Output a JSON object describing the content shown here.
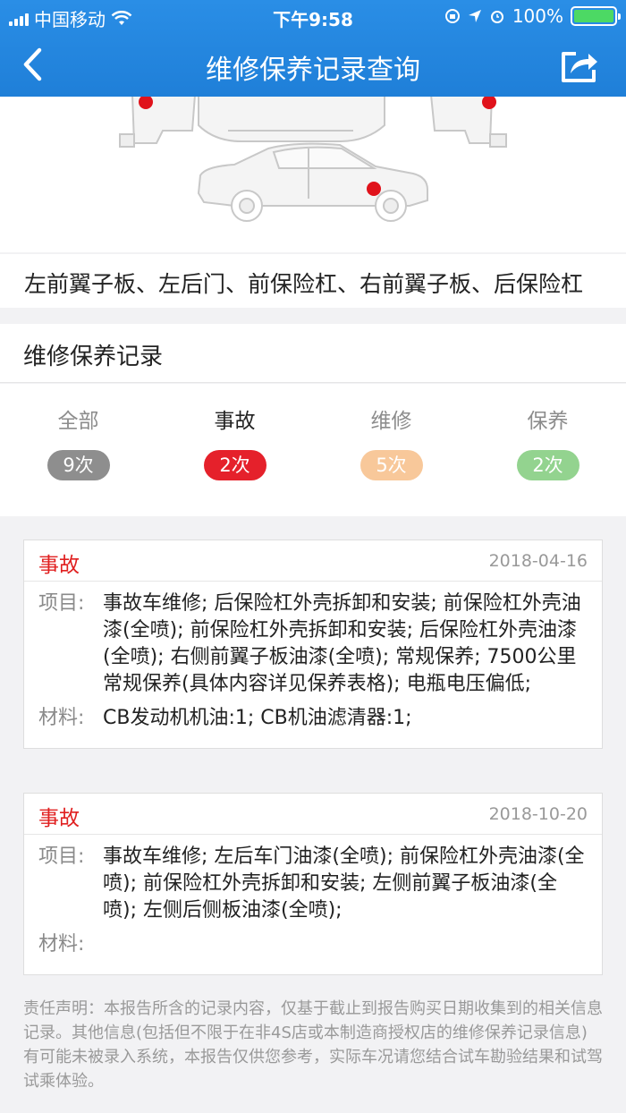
{
  "status_bar": {
    "carrier": "中国移动",
    "time": "下午9:58",
    "battery": "100%",
    "battery_fraction": 1.0
  },
  "nav": {
    "title": "维修保养记录查询",
    "back_icon": "chevron-left-icon",
    "share_icon": "share-icon"
  },
  "damage": {
    "parts": "左前翼子板、左后门、前保险杠、右前翼子板、后保险杠",
    "marker_color": "#e0121b"
  },
  "records": {
    "title": "维修保养记录",
    "filters": [
      {
        "label": "全部",
        "count": "9次",
        "color": "#8e8e8e"
      },
      {
        "label": "事故",
        "count": "2次",
        "color": "#e5212b"
      },
      {
        "label": "维修",
        "count": "5次",
        "color": "#f8c89a"
      },
      {
        "label": "保养",
        "count": "2次",
        "color": "#93d38f"
      }
    ],
    "items": [
      {
        "type": "事故",
        "date": "2018-04-16",
        "project_key": "项目:",
        "project": "事故车维修; 后保险杠外壳拆卸和安装; 前保险杠外壳油漆(全喷); 前保险杠外壳拆卸和安装; 后保险杠外壳油漆(全喷); 右侧前翼子板油漆(全喷); 常规保养; 7500公里常规保养(具体内容详见保养表格); 电瓶电压偏低;",
        "material_key": "材料:",
        "material": "CB发动机机油:1; CB机油滤清器:1;"
      },
      {
        "type": "事故",
        "date": "2018-10-20",
        "project_key": "项目:",
        "project": "事故车维修; 左后车门油漆(全喷); 前保险杠外壳油漆(全喷); 前保险杠外壳拆卸和安装; 左侧前翼子板油漆(全喷); 左侧后侧板油漆(全喷);",
        "material_key": "材料:",
        "material": ""
      }
    ]
  },
  "disclaimer": "责任声明：本报告所含的记录内容，仅基于截止到报告购买日期收集到的相关信息记录。其他信息(包括但不限于在非4S店或本制造商授权店的维修保养记录信息)有可能未被录入系统，本报告仅供您参考，实际车况请您结合试车勘验结果和试驾试乘体验。"
}
